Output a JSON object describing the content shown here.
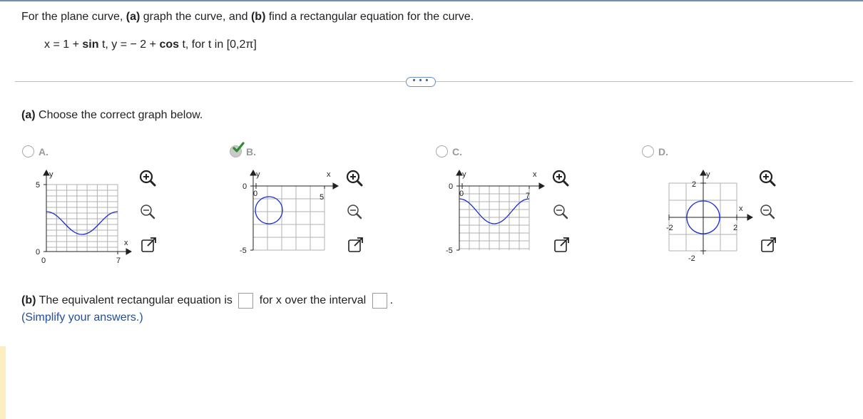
{
  "question": {
    "prefix": "For the plane curve, ",
    "part_a_tag": "(a)",
    "middle": " graph the curve, and ",
    "part_b_tag": "(b)",
    "suffix": " find a rectangular equation for the curve."
  },
  "equation": {
    "x_part": "x = 1 + ",
    "sin": "sin",
    "t1": " t, y =  − 2 + ",
    "cos": "cos",
    "t2": " t, for t in [0,2π]"
  },
  "more_button": "• • •",
  "part_a": {
    "tag": "(a)",
    "text": " Choose the correct graph below."
  },
  "options": [
    {
      "letter": "A.",
      "selected": false
    },
    {
      "letter": "B.",
      "selected": true
    },
    {
      "letter": "C.",
      "selected": false
    },
    {
      "letter": "D.",
      "selected": false
    }
  ],
  "graphs": {
    "a": {
      "ylabel": "y",
      "xlabel": "x",
      "ytick_top": "5",
      "ytick_bottom": "0",
      "xtick_left": "0",
      "xtick_right": "7"
    },
    "b": {
      "ylabel": "y",
      "xlabel": "x",
      "ytick_top": "0",
      "ytick_bottom": "-5",
      "xtick_left": "0",
      "xtick_right": "5"
    },
    "c": {
      "ylabel": "y",
      "xlabel": "x",
      "ytick_top": "0",
      "ytick_bottom": "-5",
      "xtick_left": "0",
      "xtick_right": "7"
    },
    "d": {
      "ylabel": "y",
      "xlabel": "x",
      "ytick_top": "2",
      "ytick_bottom": "-2",
      "xtick_left": "-2",
      "xtick_right": "2"
    }
  },
  "part_b": {
    "tag": "(b)",
    "text1": " The equivalent rectangular equation is ",
    "text2": " for x over the interval ",
    "text3": ".",
    "hint": "(Simplify your answers.)"
  },
  "colors": {
    "curve": "#1a2bd6",
    "check": "#2e8b2e",
    "grid": "#b0b0b0",
    "hint": "#1f4fa0"
  }
}
